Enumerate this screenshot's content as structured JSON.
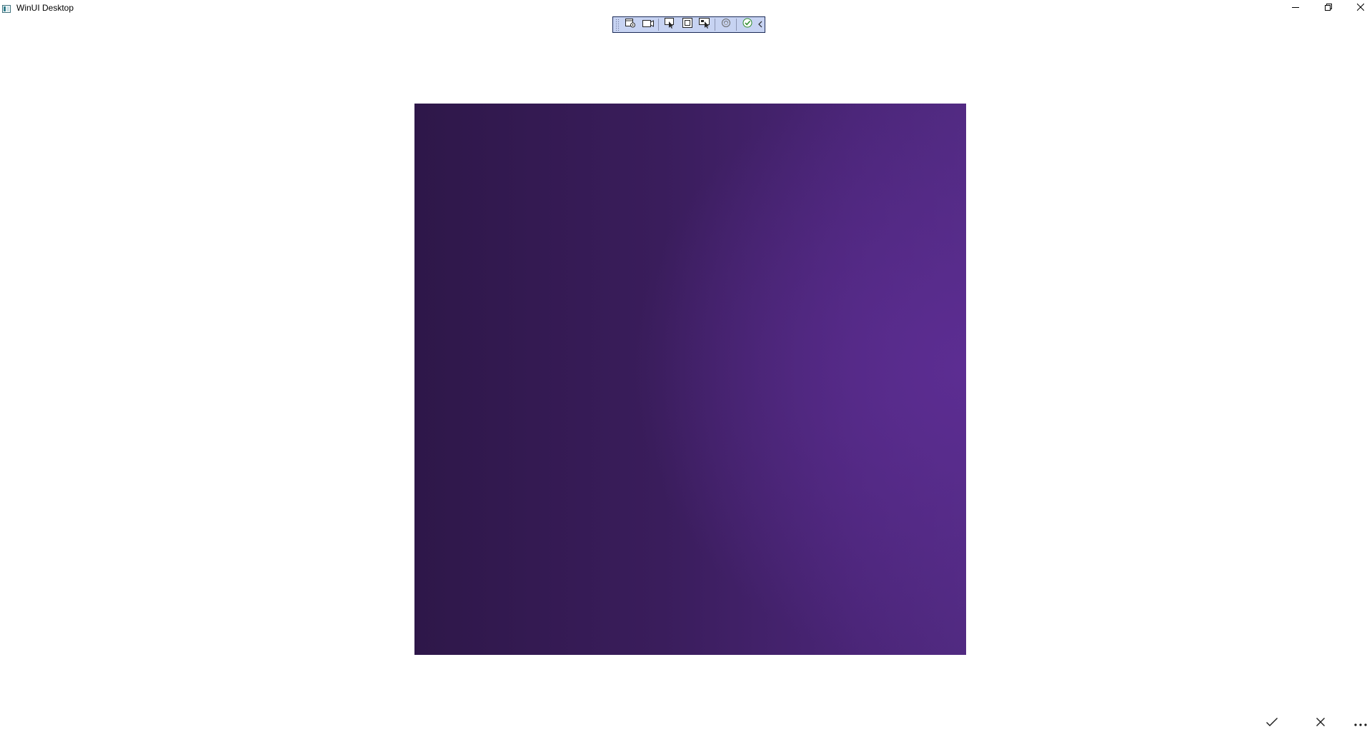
{
  "window": {
    "title": "WinUI Desktop"
  },
  "caption_buttons": {
    "minimize_icon": "minimize-icon",
    "restore_icon": "restore-icon",
    "close_icon": "close-icon"
  },
  "toolbar": {
    "buttons": [
      {
        "icon": "app-settings-icon"
      },
      {
        "icon": "video-icon"
      },
      {
        "icon": "select-element-icon"
      },
      {
        "icon": "display-layout-adorners-icon"
      },
      {
        "icon": "track-focused-element-icon"
      },
      {
        "icon": "hot-reload-icon"
      },
      {
        "icon": "accessibility-check-icon"
      },
      {
        "icon": "collapse-toolbar-icon"
      }
    ]
  },
  "canvas": {
    "colors": {
      "dark": "#2e1749",
      "light": "#5c2d92"
    }
  },
  "command_bar": {
    "accept_icon": "checkmark-icon",
    "cancel_icon": "close-icon",
    "more_icon": "more-icon"
  }
}
